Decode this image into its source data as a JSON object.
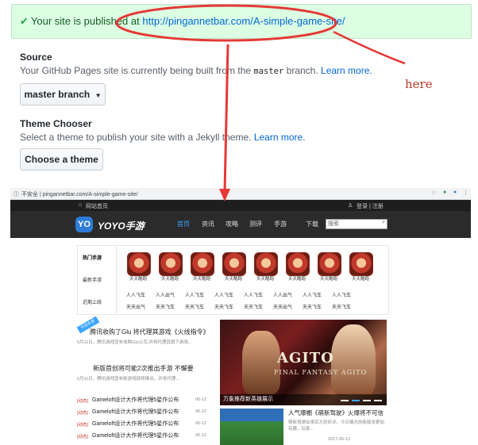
{
  "flash": {
    "prefix": "Your site is published at ",
    "url": "http://pingannetbar.com/A-simple-game-site/"
  },
  "source": {
    "title": "Source",
    "desc_before": "Your GitHub Pages site is currently being built from the ",
    "branch_code": "master",
    "desc_after": " branch. ",
    "learn_more": "Learn more.",
    "button_label": "master branch"
  },
  "theme": {
    "title": "Theme Chooser",
    "desc": "Select a theme to publish your site with a Jekyll theme. ",
    "learn_more": "Learn more.",
    "button_label": "Choose a theme"
  },
  "annotation": {
    "label": "here"
  },
  "embedded": {
    "address_bar": "不安全 | pingannetbar.com/A-simple-game-site/",
    "topbar_left": "网站首页",
    "topbar_right": "登录 | 注册",
    "logo_mark": "YO",
    "logo_text": "YOYO手游",
    "nav": [
      "首页",
      "资讯",
      "攻略",
      "测评",
      "手游",
      "下载"
    ],
    "search_placeholder": "搜索",
    "tabs": [
      "热门手游",
      "最新手游",
      "近期上线"
    ],
    "game_label": "天天酷跑",
    "game_labels": [
      "天天酷跑",
      "天天酷跑",
      "天天酷跑",
      "天天酷跑",
      "天天酷跑",
      "天天酷跑",
      "天天酷跑",
      "天天酷跑"
    ],
    "grid_rows": [
      [
        "人人飞车",
        "人人出气",
        "人人飞车",
        "人人飞车",
        "人人飞车",
        "人人出气",
        "人人飞车",
        "人人飞车"
      ],
      [
        "天天出气",
        "天天飞车",
        "天天飞车",
        "天天飞车",
        "天天飞车",
        "天天出气",
        "天天飞车",
        "天天飞车"
      ]
    ],
    "badge": "今日头条",
    "news1_title": "腾讯收购了Glu 将代理其游戏《火线指令》",
    "news1_snip": "6月11日，腾讯游戏宣布收购Glu公司,并将代理其旗下游戏...",
    "news2_title": "新版首创将可能2次推出手游 不懈要",
    "news2_snip": "6月11日，腾讯游戏宣布新游戏即将推出，并将代理...",
    "list": [
      {
        "tag": "[动态]",
        "title": "Gameloft设计大作将代理5星作公布",
        "date": "06-12"
      },
      {
        "tag": "[动态]",
        "title": "Gameloft设计大作将代理5星作公布",
        "date": "06-12"
      },
      {
        "tag": "[动态]",
        "title": "Gameloft设计大作将代理5星作公布",
        "date": "06-12"
      },
      {
        "tag": "[动态]",
        "title": "Gameloft设计大作将代理5星作公布",
        "date": "06-12"
      }
    ],
    "hero_title": "AGITO",
    "hero_subtitle": "FINAL FANTASY AGITO",
    "hero_caption": "万象推荐新英雄展示",
    "side_title": "人气爆棚《萌新驾驶》火爆将不可信",
    "side_snip": "萌新驾驶出来后大获好评，今日曝光的新版本更加有趣，玩家...",
    "side_date": "2017-06-12"
  },
  "colors": {
    "flash_bg": "#dcffe4",
    "link": "#0366d6",
    "annotation_red": "#e53935",
    "nav_active": "#3ea6ff"
  }
}
